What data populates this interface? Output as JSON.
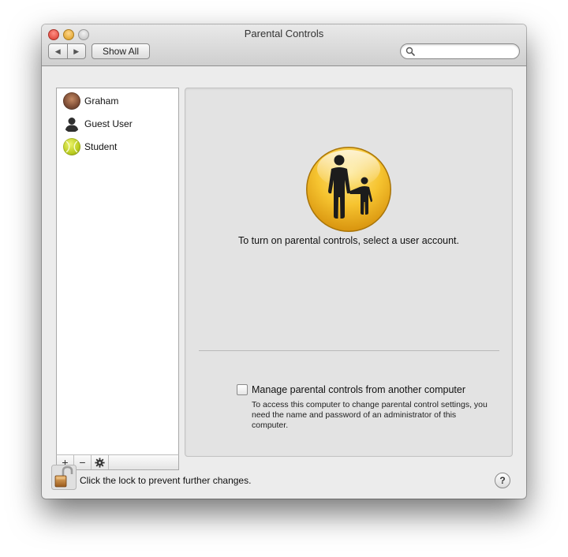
{
  "window": {
    "title": "Parental Controls"
  },
  "toolbar": {
    "back_icon": "◀",
    "forward_icon": "▶",
    "show_all_label": "Show All",
    "search_placeholder": ""
  },
  "sidebar": {
    "users": [
      {
        "name": "Graham",
        "avatar": "graham-avatar"
      },
      {
        "name": "Guest User",
        "avatar": "guest-user-icon"
      },
      {
        "name": "Student",
        "avatar": "tennis-ball-avatar"
      }
    ],
    "toolbar": {
      "add_label": "+",
      "remove_label": "−",
      "action_icon": "gear-icon"
    }
  },
  "main": {
    "prompt": "To turn on parental controls, select a user account.",
    "manage_checkbox_label": "Manage parental controls from another computer",
    "manage_checked": false,
    "manage_description": "To access this computer to change parental control settings, you need the name and password of an administrator of this computer."
  },
  "footer": {
    "lock_text": "Click the lock to prevent further changes.",
    "lock_state": "unlocked",
    "help_label": "?"
  },
  "colors": {
    "icon_yellow": "#f6c430",
    "window_bg": "#ececec",
    "panel_bg": "#e3e3e3"
  }
}
